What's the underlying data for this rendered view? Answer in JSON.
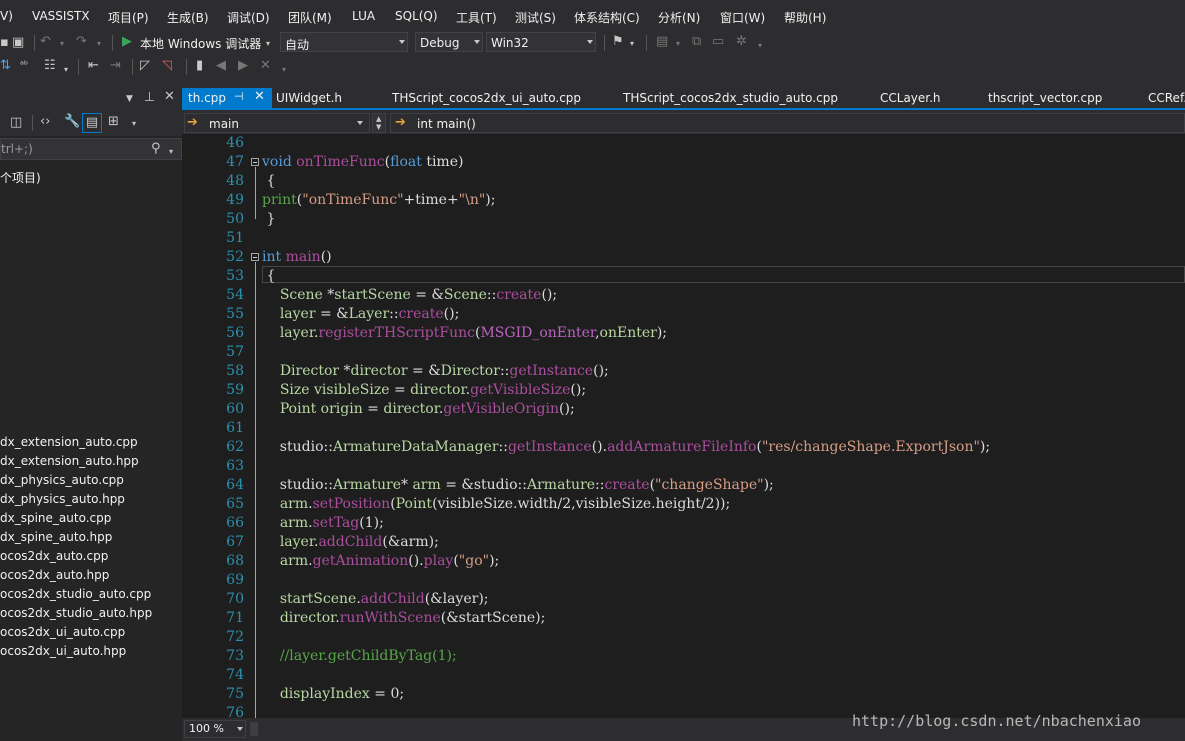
{
  "menubar": {
    "items": [
      "V)",
      "VASSISTX",
      "项目(P)",
      "生成(B)",
      "调试(D)",
      "团队(M)",
      "LUA",
      "SQL(Q)",
      "工具(T)",
      "测试(S)",
      "体系结构(C)",
      "分析(N)",
      "窗口(W)",
      "帮助(H)"
    ]
  },
  "toolbar": {
    "debugger_label": "本地 Windows 调试器",
    "auto_combo": "自动",
    "config_combo": "Debug",
    "platform_combo": "Win32"
  },
  "solution_explorer": {
    "search_placeholder": "trl+;)",
    "root_item": "个项目)",
    "files": [
      "dx_extension_auto.cpp",
      "dx_extension_auto.hpp",
      "dx_physics_auto.cpp",
      "dx_physics_auto.hpp",
      "dx_spine_auto.cpp",
      "dx_spine_auto.hpp",
      "ocos2dx_auto.cpp",
      "ocos2dx_auto.hpp",
      "ocos2dx_studio_auto.cpp",
      "ocos2dx_studio_auto.hpp",
      "ocos2dx_ui_auto.cpp",
      "ocos2dx_ui_auto.hpp"
    ]
  },
  "tabs": {
    "active": "th.cpp",
    "others": [
      "UIWidget.h",
      "THScript_cocos2dx_ui_auto.cpp",
      "THScript_cocos2dx_studio_auto.cpp",
      "CCLayer.h",
      "thscript_vector.cpp",
      "CCRef.h"
    ]
  },
  "navbar": {
    "scope": "main",
    "member": "int main()"
  },
  "editor": {
    "line_numbers": [
      "46",
      "47",
      "48",
      "49",
      "50",
      "51",
      "52",
      "53",
      "54",
      "55",
      "56",
      "57",
      "58",
      "59",
      "60",
      "61",
      "62",
      "63",
      "64",
      "65",
      "66",
      "67",
      "68",
      "69",
      "70",
      "71",
      "72",
      "73",
      "74",
      "75",
      "76"
    ]
  },
  "zoom": {
    "level": "100 %"
  },
  "watermark": "http://blog.csdn.net/nbachenxiao",
  "colors": {
    "accent": "#007acc",
    "keyword": "#569cd6",
    "function": "#ab4e9e",
    "type": "#4ec9b0",
    "string": "#d69d85",
    "comment": "#57a64a",
    "line_number": "#2b91af"
  }
}
